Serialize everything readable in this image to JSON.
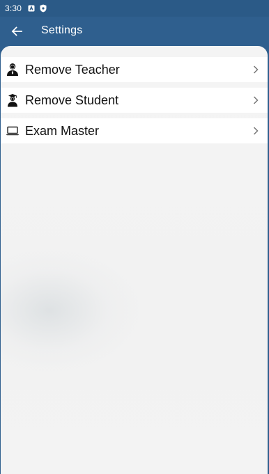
{
  "status_bar": {
    "time": "3:30",
    "icons": [
      "a-badge-icon",
      "shield-icon"
    ]
  },
  "app_bar": {
    "title": "Settings",
    "back_icon": "arrow-left-icon"
  },
  "menu": {
    "items": [
      {
        "label": "Remove Teacher",
        "icon": "teacher-icon"
      },
      {
        "label": "Remove Student",
        "icon": "student-icon"
      },
      {
        "label": "Exam Master",
        "icon": "laptop-icon"
      }
    ]
  },
  "colors": {
    "app_bar": "#2f5f8e",
    "status_bar": "#2b5a87",
    "background": "#f3f3f3",
    "item_bg": "#ffffff",
    "text": "#111111"
  }
}
